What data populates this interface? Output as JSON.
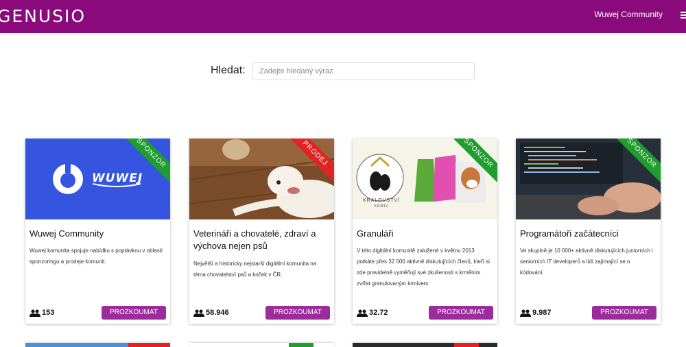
{
  "nav": {
    "brand": "GENUSIO",
    "community_link": "Wuwej Community",
    "menu_icon": "hamburger-icon"
  },
  "search": {
    "label": "Hledat:",
    "placeholder": "Zadejte hledaný výraz",
    "value": ""
  },
  "cards": [
    {
      "title": "Wuwej Community",
      "ribbon": "SPONZOR",
      "description": "Wuwej komunita spojuje nabídku s poptávkou v oblasti sponzoringu a prodeje komunit.",
      "members": "153",
      "button": "PROZKOUMAT",
      "logo_text": "WUWEJ"
    },
    {
      "title": "Veterináři a chovatelé, zdraví a výchova nejen psů",
      "ribbon": "PRODEJ",
      "description": "Největší a historicky nejstarší digitální komunita na téma chovatelství psů a koček v ČR.",
      "members": "58.946",
      "button": "PROZKOUMAT"
    },
    {
      "title": "Granuláři",
      "ribbon": "SPONZOR",
      "description": "V této digitální komunitě založené v květnu 2013 potkáte přes 32 000 aktivně diskutujících členů, kteří si zde pravidelně vyměňují své zkušenosti s krměním zvířat granulovaným krmivem.",
      "members": "32.72",
      "button": "PROZKOUMAT",
      "logo_text": "KRÁLOVSTVÍ",
      "logo_subtext": "KRMIV"
    },
    {
      "title": "Programátoři začátecníci",
      "ribbon": "SPONZOR",
      "description": "Ve skupině je 10 000+ aktivně diskutujících juniorních i seniorních IT developerů a lidí zajímající se o kódování.",
      "members": "9.987",
      "button": "PROZKOUMAT"
    }
  ],
  "colors": {
    "navbar": "#8a0a7c",
    "button": "#9c2b9b",
    "sponsor_ribbon": "#1e9e2c",
    "sale_ribbon": "#e02424"
  }
}
